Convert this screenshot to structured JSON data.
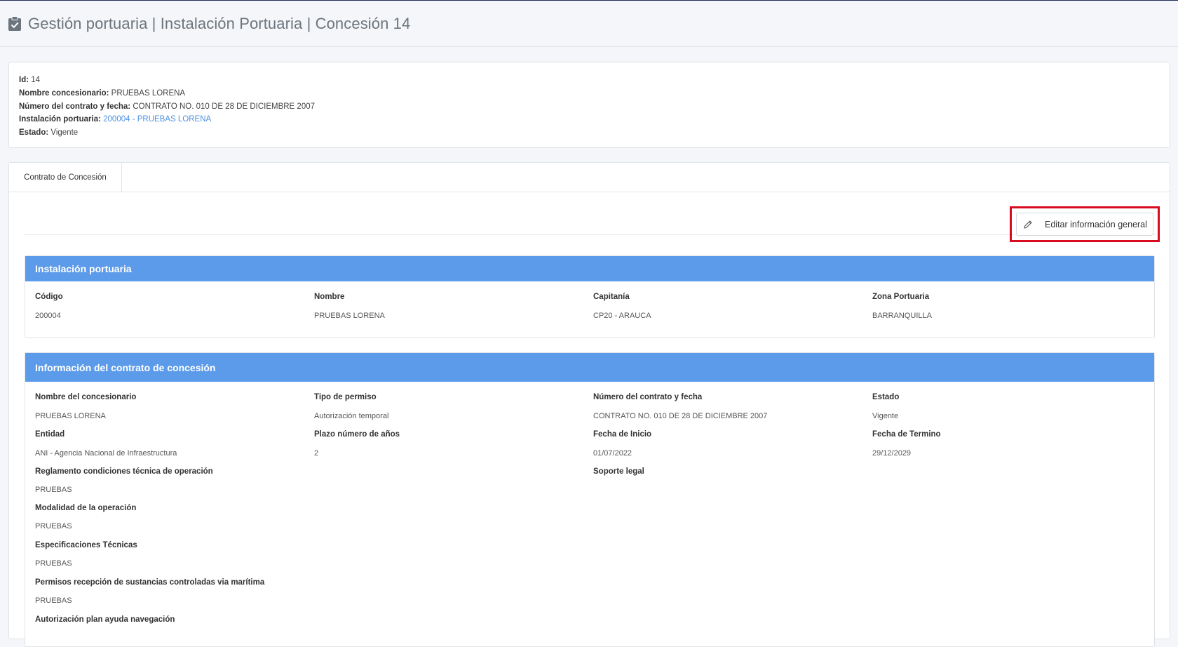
{
  "header": {
    "title": "Gestión portuaria | Instalación Portuaria | Concesión 14"
  },
  "summary": {
    "id_label": "Id:",
    "id_value": "14",
    "nombre_label": "Nombre concesionario:",
    "nombre_value": "PRUEBAS LORENA",
    "contrato_label": "Número del contrato y fecha:",
    "contrato_value": "CONTRATO NO. 010 DE 28 DE DICIEMBRE 2007",
    "instalacion_label": "Instalación portuaria:",
    "instalacion_value": "200004 - PRUEBAS LORENA",
    "estado_label": "Estado:",
    "estado_value": "Vigente"
  },
  "tabs": [
    {
      "label": "Contrato de Concesión"
    }
  ],
  "toolbar": {
    "edit_label": "Editar información general",
    "edit_icon": "pencil-icon"
  },
  "instalacion": {
    "title": "Instalación portuaria",
    "fields": [
      {
        "label": "Código",
        "value": "200004"
      },
      {
        "label": "Nombre",
        "value": "PRUEBAS LORENA"
      },
      {
        "label": "Capitanía",
        "value": "CP20 - ARAUCA"
      },
      {
        "label": "Zona Portuaria",
        "value": "BARRANQUILLA"
      }
    ]
  },
  "contrato": {
    "title": "Información del contrato de concesión",
    "fields": [
      {
        "label": "Nombre del concesionario",
        "value": "PRUEBAS LORENA"
      },
      {
        "label": "Tipo de permiso",
        "value": "Autorización temporal"
      },
      {
        "label": "Número del contrato y fecha",
        "value": "CONTRATO NO. 010 DE 28 DE DICIEMBRE 2007"
      },
      {
        "label": "Estado",
        "value": "Vigente"
      },
      {
        "label": "Entidad",
        "value": "ANI - Agencia Nacional de Infraestructura"
      },
      {
        "label": "Plazo número de años",
        "value": "2"
      },
      {
        "label": "Fecha de Inicio",
        "value": "01/07/2022"
      },
      {
        "label": "Fecha de Termino",
        "value": "29/12/2029"
      },
      {
        "label": "Reglamento condiciones técnica de operación",
        "value": "PRUEBAS"
      },
      {
        "label": "Soporte legal",
        "value": ""
      },
      {
        "label": "Modalidad de la operación",
        "value": "PRUEBAS"
      },
      {
        "label": "Especificaciones Técnicas",
        "value": "PRUEBAS"
      },
      {
        "label": "Permisos recepción de sustancias controladas via marítima",
        "value": "PRUEBAS"
      },
      {
        "label": "Autorización plan ayuda navegación",
        "value": ""
      }
    ]
  },
  "colors": {
    "panel_header": "#5c9bea",
    "highlight": "#d90b1f",
    "link": "#4d90e0"
  }
}
